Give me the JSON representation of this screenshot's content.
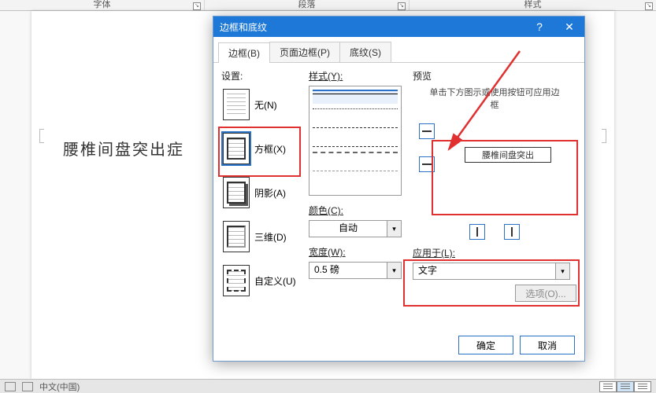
{
  "ribbon": {
    "group_font": "字体",
    "group_paragraph": "段落",
    "group_styles": "样式"
  },
  "document": {
    "text": "腰椎间盘突出症"
  },
  "status": {
    "language": "中文(中国)"
  },
  "dialog": {
    "title": "边框和底纹",
    "help": "?",
    "close": "✕",
    "tabs": {
      "borders": "边框(B)",
      "page_borders": "页面边框(P)",
      "shading": "底纹(S)"
    },
    "settings": {
      "label": "设置:",
      "none": "无(N)",
      "box": "方框(X)",
      "shadow": "阴影(A)",
      "threeD": "三维(D)",
      "custom": "自定义(U)"
    },
    "style": {
      "label": "样式(Y):",
      "color_label": "颜色(C):",
      "color_value": "自动",
      "width_label": "宽度(W):",
      "width_value": "0.5 磅"
    },
    "preview": {
      "label": "预览",
      "hint": "单击下方图示或使用按钮可应用边框",
      "sample_text": "腰椎间盘突出"
    },
    "apply": {
      "label": "应用于(L):",
      "value": "文字"
    },
    "options_label": "选项(O)...",
    "ok": "确定",
    "cancel": "取消"
  }
}
